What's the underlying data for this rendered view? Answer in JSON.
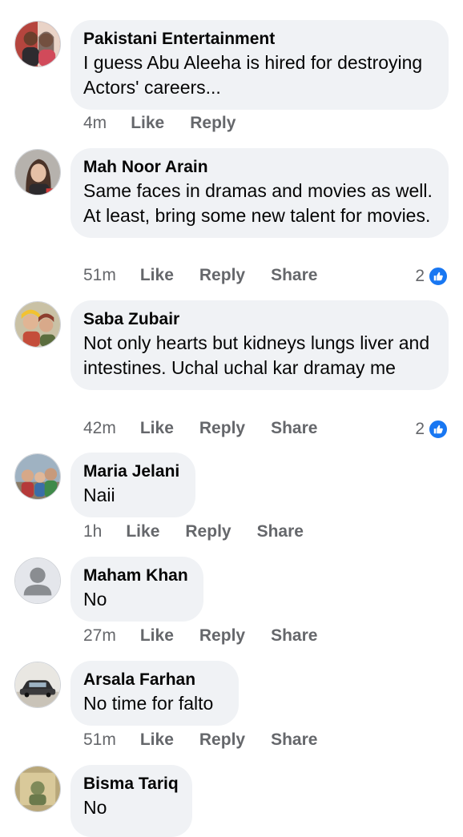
{
  "colors": {
    "bubble": "#f0f2f5",
    "meta": "#65676b",
    "like_badge": "#1877f2"
  },
  "comments": [
    {
      "author": "Pakistani Entertainment",
      "text": "I guess Abu Aleeha is hired for destroying Actors' careers...",
      "time": "4m",
      "like": "Like",
      "reply": "Reply",
      "share": "",
      "reactions": "",
      "avatar_icon": "profile-photo"
    },
    {
      "author": "Mah Noor Arain",
      "text": "Same faces in dramas and movies as well. At least, bring some new talent for movies.",
      "time": "51m",
      "like": "Like",
      "reply": "Reply",
      "share": "Share",
      "reactions": "2",
      "avatar_icon": "profile-photo"
    },
    {
      "author": "Saba Zubair",
      "text": "Not only hearts but kidneys lungs liver and intestines. Uchal uchal kar dramay me",
      "time": "42m",
      "like": "Like",
      "reply": "Reply",
      "share": "Share",
      "reactions": "2",
      "avatar_icon": "profile-photo"
    },
    {
      "author": "Maria Jelani",
      "text": "Naii",
      "time": "1h",
      "like": "Like",
      "reply": "Reply",
      "share": "Share",
      "reactions": "",
      "avatar_icon": "profile-photo"
    },
    {
      "author": "Maham Khan",
      "text": "No",
      "time": "27m",
      "like": "Like",
      "reply": "Reply",
      "share": "Share",
      "reactions": "",
      "avatar_icon": "default-avatar"
    },
    {
      "author": "Arsala Farhan",
      "text": "No time for falto",
      "time": "51m",
      "like": "Like",
      "reply": "Reply",
      "share": "Share",
      "reactions": "",
      "avatar_icon": "car-photo"
    },
    {
      "author": "Bisma Tariq",
      "text": "No",
      "time": "",
      "like": "",
      "reply": "",
      "share": "",
      "reactions": "",
      "avatar_icon": "profile-photo"
    }
  ]
}
